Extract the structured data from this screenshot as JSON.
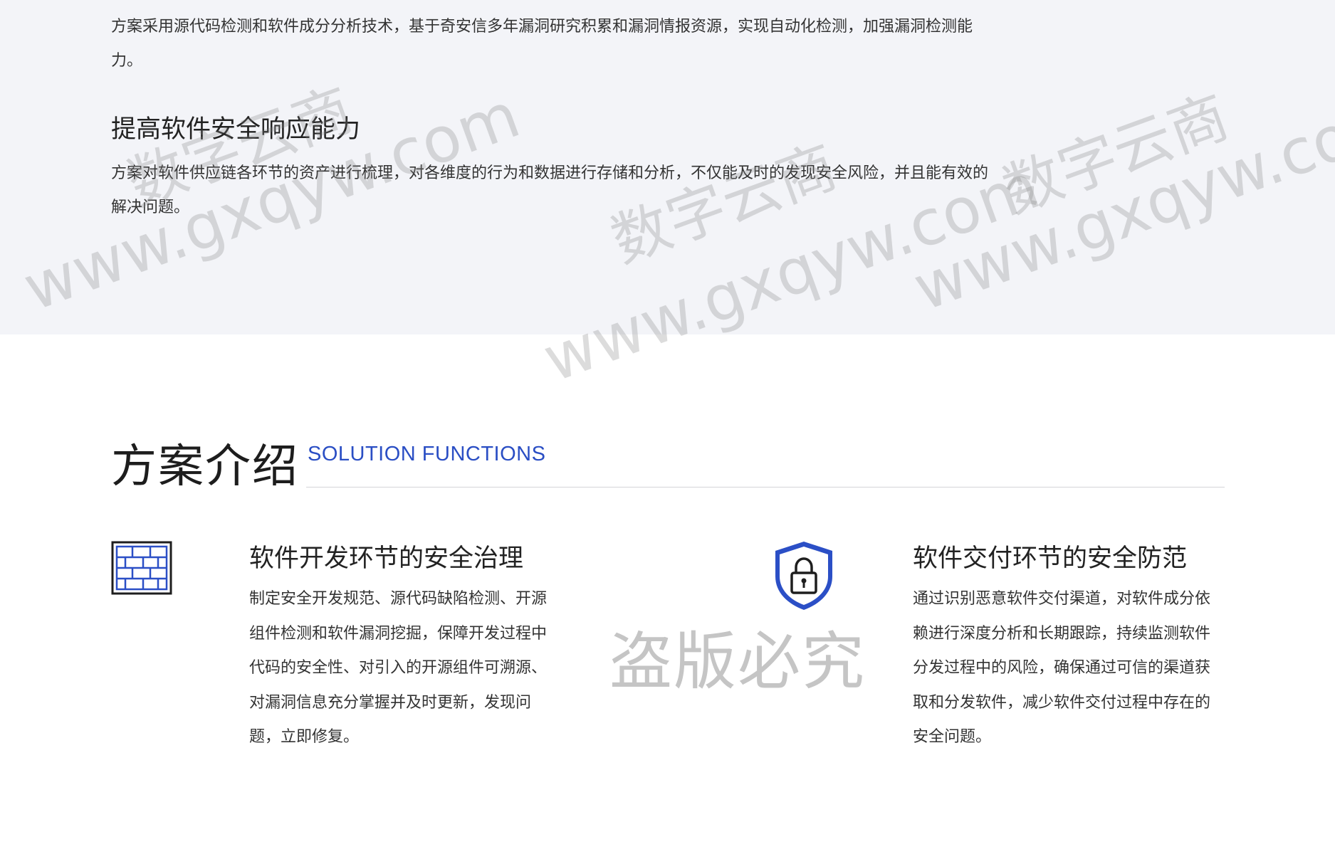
{
  "intro": {
    "para1": "方案采用源代码检测和软件成分分析技术，基于奇安信多年漏洞研究积累和漏洞情报资源，实现自动化检测，加强漏洞检测能力。",
    "heading2": "提高软件安全响应能力",
    "para2": "方案对软件供应链各环节的资产进行梳理，对各维度的行为和数据进行存储和分析，不仅能及时的发现安全风险，并且能有效的解决问题。"
  },
  "section": {
    "title": "方案介绍",
    "subtitle": "SOLUTION FUNCTIONS"
  },
  "features": [
    {
      "icon": "brick-wall-icon",
      "title": "软件开发环节的安全治理",
      "desc": "制定安全开发规范、源代码缺陷检测、开源组件检测和软件漏洞挖掘，保障开发过程中代码的安全性、对引入的开源组件可溯源、对漏洞信息充分掌握并及时更新，发现问题，立即修复。"
    },
    {
      "icon": "shield-lock-icon",
      "title": "软件交付环节的安全防范",
      "desc": "通过识别恶意软件交付渠道，对软件成分依赖进行深度分析和长期跟踪，持续监测软件分发过程中的风险，确保通过可信的渠道获取和分发软件，减少软件交付过程中存在的安全问题。"
    }
  ],
  "watermark": {
    "cn": "数字云商",
    "url": "www.gxqyw.com",
    "stamp": "盗版必究"
  },
  "colors": {
    "accent": "#2a4ec4",
    "band": "#f3f4f8"
  }
}
